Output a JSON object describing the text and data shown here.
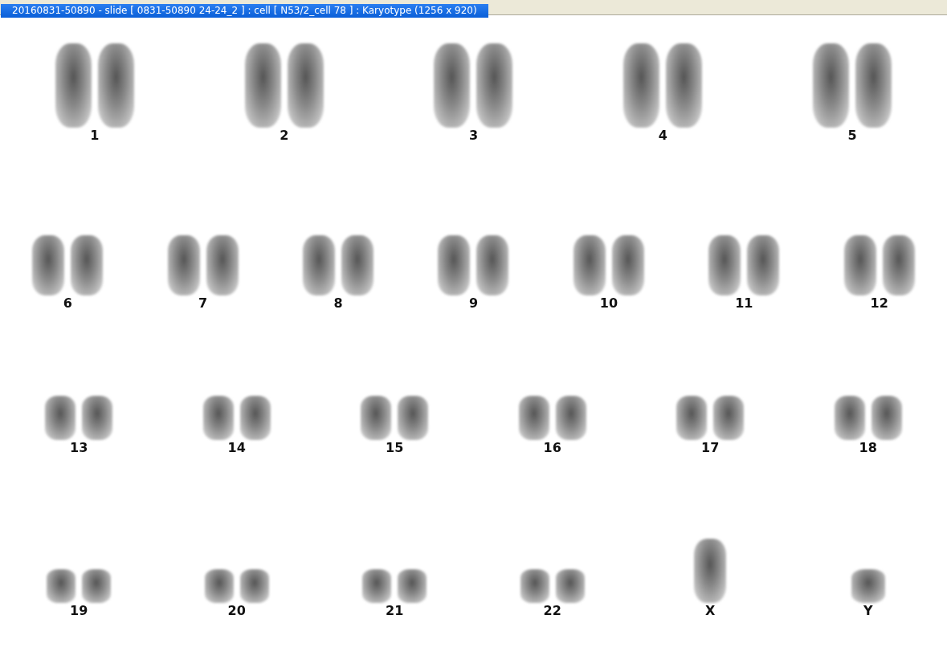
{
  "window": {
    "title": "20160831-50890 - slide [ 0831-50890 24-24_2 ] : cell [ N53/2_cell 78 ] : Karyotype  (1256 x 920)"
  },
  "rows": [
    {
      "groups": [
        {
          "label": "1",
          "kind": "pair"
        },
        {
          "label": "2",
          "kind": "pair"
        },
        {
          "label": "3",
          "kind": "pair"
        },
        {
          "label": "4",
          "kind": "pair"
        },
        {
          "label": "5",
          "kind": "pair"
        }
      ]
    },
    {
      "groups": [
        {
          "label": "6",
          "kind": "pair"
        },
        {
          "label": "7",
          "kind": "pair"
        },
        {
          "label": "8",
          "kind": "pair"
        },
        {
          "label": "9",
          "kind": "pair"
        },
        {
          "label": "10",
          "kind": "pair"
        },
        {
          "label": "11",
          "kind": "pair"
        },
        {
          "label": "12",
          "kind": "pair"
        }
      ]
    },
    {
      "groups": [
        {
          "label": "13",
          "kind": "pair"
        },
        {
          "label": "14",
          "kind": "pair"
        },
        {
          "label": "15",
          "kind": "pair"
        },
        {
          "label": "16",
          "kind": "pair"
        },
        {
          "label": "17",
          "kind": "pair"
        },
        {
          "label": "18",
          "kind": "pair"
        }
      ]
    },
    {
      "groups": [
        {
          "label": "19",
          "kind": "pair"
        },
        {
          "label": "20",
          "kind": "pair"
        },
        {
          "label": "21",
          "kind": "pair"
        },
        {
          "label": "22",
          "kind": "pair"
        },
        {
          "label": "X",
          "kind": "single-large"
        },
        {
          "label": "Y",
          "kind": "single"
        }
      ]
    }
  ]
}
